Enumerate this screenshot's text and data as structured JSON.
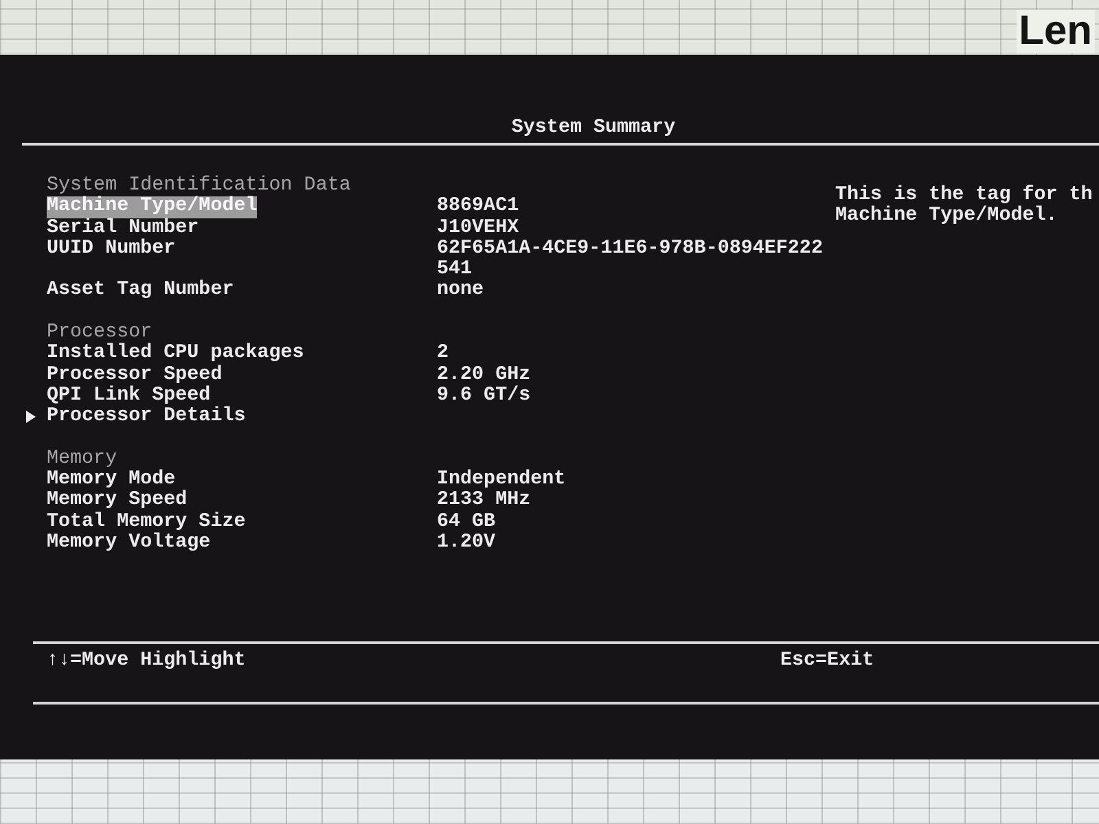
{
  "backdrop": {
    "logo_text": "Len"
  },
  "screen": {
    "title": "System Summary",
    "sections": [
      {
        "title": "System Identification Data",
        "items": [
          {
            "kind": "info",
            "label": "Machine Type/Model",
            "value": "8869AC1",
            "selected": true
          },
          {
            "kind": "info",
            "label": "Serial Number",
            "value": "J10VEHX",
            "selected": false
          },
          {
            "kind": "info",
            "label": "UUID Number",
            "value": "62F65A1A-4CE9-11E6-978B-0894EF222541",
            "selected": false
          },
          {
            "kind": "info",
            "label": "Asset Tag Number",
            "value": "none",
            "selected": false
          }
        ]
      },
      {
        "title": "Processor",
        "items": [
          {
            "kind": "info",
            "label": "Installed CPU packages",
            "value": "2",
            "selected": false
          },
          {
            "kind": "info",
            "label": "Processor Speed",
            "value": "2.20 GHz",
            "selected": false
          },
          {
            "kind": "info",
            "label": "QPI Link Speed",
            "value": "9.6 GT/s",
            "selected": false
          },
          {
            "kind": "submenu",
            "label": "Processor Details",
            "selected": false
          }
        ]
      },
      {
        "title": "Memory",
        "items": [
          {
            "kind": "info",
            "label": "Memory Mode",
            "value": "Independent",
            "selected": false
          },
          {
            "kind": "info",
            "label": "Memory Speed",
            "value": "2133 MHz",
            "selected": false
          },
          {
            "kind": "info",
            "label": "Total Memory Size",
            "value": "64 GB",
            "selected": false
          },
          {
            "kind": "info",
            "label": "Memory Voltage",
            "value": "1.20V",
            "selected": false
          }
        ]
      }
    ],
    "help_text": "This is the tag for th Machine Type/Model.",
    "key_hints": [
      "↑↓=Move Highlight",
      "Esc=Exit"
    ]
  }
}
